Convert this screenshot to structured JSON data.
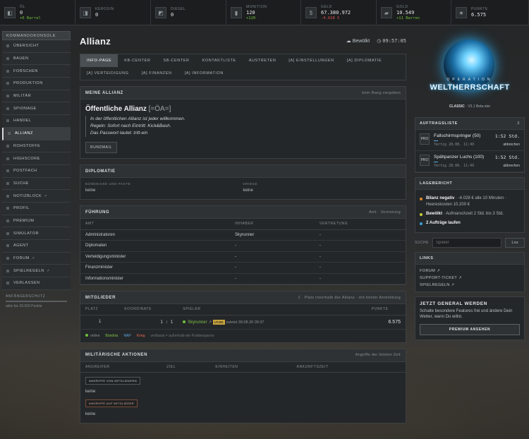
{
  "resources": [
    {
      "label": "Öl",
      "value": "0",
      "sub": "+0 Barrel",
      "sub_color": "g",
      "icon": "oil-icon",
      "glyph": "◧"
    },
    {
      "label": "Kerosin",
      "value": "0",
      "sub": "",
      "sub_color": "",
      "icon": "kerosene-icon",
      "glyph": "◨"
    },
    {
      "label": "Diesel",
      "value": "0",
      "sub": "",
      "sub_color": "",
      "icon": "diesel-icon",
      "glyph": "◩"
    },
    {
      "label": "Munition",
      "value": "120",
      "sub": "+120",
      "sub_color": "g",
      "icon": "ammo-icon",
      "glyph": "▮"
    },
    {
      "label": "Geld",
      "value": "67.380.972",
      "sub": "-4.028 €",
      "sub_color": "r",
      "icon": "money-icon",
      "glyph": "$"
    },
    {
      "label": "Gold",
      "value": "10.549",
      "sub": "+11 Barren",
      "sub_color": "g",
      "icon": "gold-icon",
      "glyph": "▰"
    },
    {
      "label": "Punkte",
      "value": "6.575",
      "sub": "",
      "sub_color": "",
      "icon": "points-icon",
      "glyph": "★"
    }
  ],
  "sidebar": {
    "header": "Kommandokonsole",
    "items": [
      {
        "label": "Übersicht",
        "ext": ""
      },
      {
        "label": "Bauen",
        "ext": ""
      },
      {
        "label": "Forschen",
        "ext": ""
      },
      {
        "label": "Produktion",
        "ext": ""
      },
      {
        "label": "Militär",
        "ext": ""
      },
      {
        "label": "Spionage",
        "ext": ""
      },
      {
        "label": "Handel",
        "ext": ""
      },
      {
        "label": "Allianz",
        "ext": "",
        "active": true
      },
      {
        "label": "Rohstoffe",
        "ext": ""
      },
      {
        "label": "Highscore",
        "ext": ""
      },
      {
        "label": "Postfach",
        "ext": ""
      },
      {
        "label": "Suche",
        "ext": ""
      },
      {
        "label": "Notizblock",
        "ext": "↗"
      },
      {
        "label": "Profil",
        "ext": ""
      },
      {
        "label": "Premium",
        "ext": ""
      },
      {
        "label": "Simulator",
        "ext": ""
      },
      {
        "label": "Agent",
        "ext": ""
      },
      {
        "label": "Forum",
        "ext": "↗"
      },
      {
        "label": "Spielregeln",
        "ext": "↗"
      },
      {
        "label": "Verlassen",
        "ext": ""
      }
    ],
    "protection_title": "Anfängerschutz",
    "protection_text": "aktiv bis 20.000 Punkte"
  },
  "header": {
    "title": "Allianz",
    "weather": "Bewölkt",
    "time": "09:57:05"
  },
  "tabs": {
    "row1": [
      "Info-Page",
      "KB-Center",
      "SB-Center",
      "Kontaktliste",
      "Austreten",
      "[A] Einstellungen",
      "[A] Diplomatie"
    ],
    "row2": [
      "[A] Verteidigung",
      "[A] Finanzen",
      "[A] Information"
    ]
  },
  "my_alliance": {
    "title": "Meine Allianz",
    "rank": "kein Rang vergeben",
    "name": "Öffentliche Allianz",
    "tag": "[=ÖA=]",
    "lines": [
      "In der öffentlichen Allianz ist jeder willkommen.",
      "Regeln: Sofort nach Eintritt: Kick&Bash.",
      "Das Passwort lautet: tritt-ein"
    ],
    "button": "Rundmail"
  },
  "diplomacy": {
    "title": "Diplomatie",
    "col1": "Bündnisse und Pakte",
    "col2": "Kriege",
    "val1": "keine",
    "val2": "keine"
  },
  "leadership": {
    "title": "Führung",
    "right": "Amt · Vertretung",
    "headers": [
      "Amt",
      "Inhaber",
      "Vertretung"
    ],
    "rows": [
      [
        "Administratoren",
        "Skyrunner",
        "-"
      ],
      [
        "Diplomaten",
        "-",
        "-"
      ],
      [
        "Verteidigungsminister",
        "-",
        "-"
      ],
      [
        "Finanzminister",
        "-",
        "-"
      ],
      [
        "Informationsminister",
        "-",
        "-"
      ]
    ]
  },
  "members": {
    "title": "Mitglieder",
    "right": "1 · Platz innerhalb der Allianz · mit letzter Anmeldung",
    "headers": [
      "Platz",
      "Koordinate",
      "Spieler",
      "Punkte"
    ],
    "row": {
      "rank": "1",
      "coord": "1 : 1",
      "player": "Skyrunner",
      "ext": "↗",
      "chip": "LT.OK",
      "last": "zuletzt 28.08.26 09:37",
      "points": "6.575"
    },
    "legend": {
      "online": "online",
      "ally": "Bündnis",
      "nap": "NAP",
      "war": "Krieg",
      "note": "verblasst = außerhalb der Punktespanne"
    }
  },
  "military": {
    "title": "Militärische Aktionen",
    "right": "Angriffe der letzten Zeit",
    "headers": [
      "Angreifer",
      "Ziel",
      "Einheiten",
      "Ankunftszeit"
    ],
    "btn_from": "Angriffe von Mitgliedern",
    "val_from": "keine",
    "btn_on": "Angriffe auf Mitglieder",
    "val_on": "keine"
  },
  "logo": {
    "op": "OPERATION",
    "brand": "WELTHERRSCHAFT",
    "classic": "CLASSIC",
    "version": "V3.1 Beta-ster"
  },
  "orders": {
    "title": "Auftragsliste",
    "count": "2",
    "items": [
      {
        "badge": "PRO",
        "name": "Fallschirmspringer (50)",
        "time": "1:52 Std.",
        "done": "fertig 28.08. 11:49",
        "cancel": "abbrechen"
      },
      {
        "badge": "PRO",
        "name": "Spähpanzer Luchs (100)",
        "time": "1:52 Std.",
        "done": "fertig 28.08. 11:49",
        "cancel": "abbrechen"
      }
    ]
  },
  "report": {
    "title": "Lagebericht",
    "items": [
      {
        "bold": "Bilanz negativ",
        "text": " · -4.028 € alle 10 Minuten · Heereskosten 10.200 €",
        "color": "#e28a2b"
      },
      {
        "bold": "Bewölkt",
        "text": " · Aufmarschzeit 2 Std. bis 3 Std.",
        "color": "#c8d23a"
      },
      {
        "bold": "2 Aufträge laufen",
        "text": "",
        "color": "#3aa0e0"
      }
    ]
  },
  "search": {
    "label": "Suche",
    "placeholder": "Spieler",
    "button": "Los"
  },
  "links": {
    "title": "Links",
    "items": [
      "Forum ↗",
      "Support-Ticket ↗",
      "Spielregeln ↗"
    ]
  },
  "general": {
    "title": "Jetzt General werden",
    "desc": "Schalte besondere Features frei und ändere Dein Wetter, wann Du willst.",
    "button": "Premium ansehen"
  }
}
